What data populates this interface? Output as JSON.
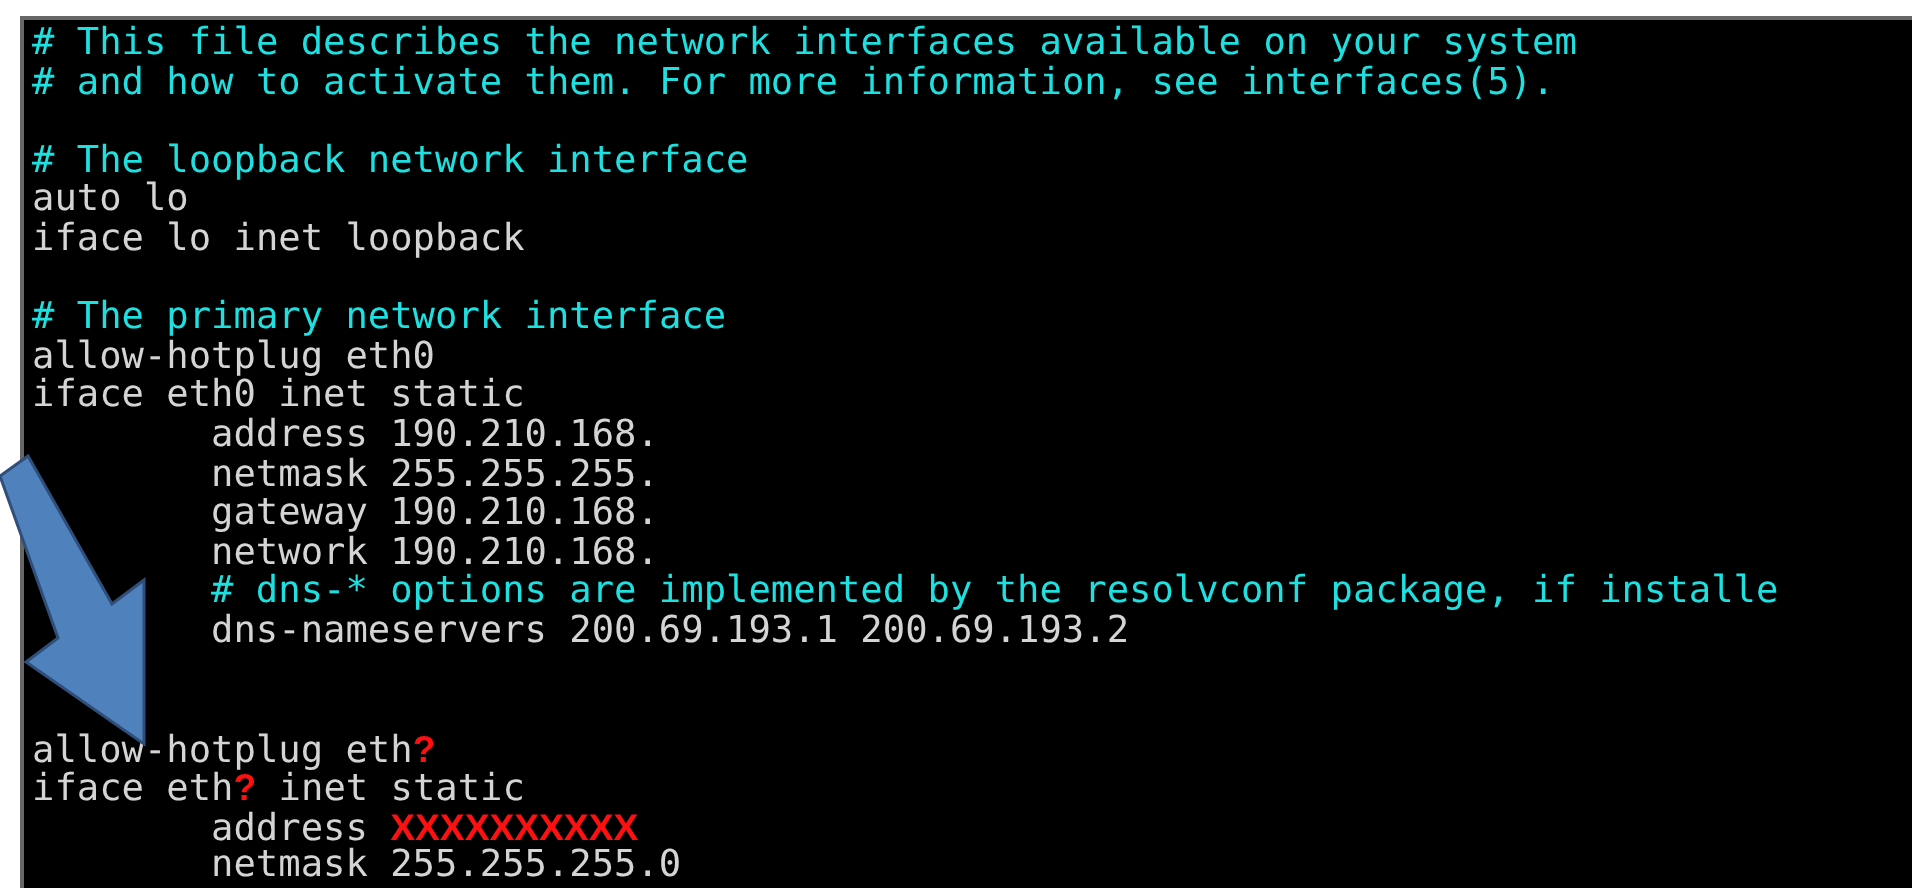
{
  "terminal": {
    "lines": [
      {
        "kind": "comment",
        "indented": false,
        "segments": [
          {
            "kind": "normal",
            "text": "# This file describes the network interfaces available on your system"
          }
        ]
      },
      {
        "kind": "comment",
        "indented": false,
        "segments": [
          {
            "kind": "normal",
            "text": "# and how to activate them. For more information, see interfaces(5)."
          }
        ]
      },
      {
        "kind": "blank"
      },
      {
        "kind": "comment",
        "indented": false,
        "segments": [
          {
            "kind": "normal",
            "text": "# The loopback network interface"
          }
        ]
      },
      {
        "kind": "plain",
        "indented": false,
        "segments": [
          {
            "kind": "normal",
            "text": "auto lo"
          }
        ]
      },
      {
        "kind": "plain",
        "indented": false,
        "segments": [
          {
            "kind": "normal",
            "text": "iface lo inet loopback"
          }
        ]
      },
      {
        "kind": "blank"
      },
      {
        "kind": "comment",
        "indented": false,
        "segments": [
          {
            "kind": "normal",
            "text": "# The primary network interface"
          }
        ]
      },
      {
        "kind": "plain",
        "indented": false,
        "segments": [
          {
            "kind": "normal",
            "text": "allow-hotplug eth0"
          }
        ]
      },
      {
        "kind": "plain",
        "indented": false,
        "segments": [
          {
            "kind": "normal",
            "text": "iface eth0 inet static"
          }
        ]
      },
      {
        "kind": "plain",
        "indented": true,
        "segments": [
          {
            "kind": "normal",
            "text": "address 190.210.168."
          }
        ]
      },
      {
        "kind": "plain",
        "indented": true,
        "segments": [
          {
            "kind": "normal",
            "text": "netmask 255.255.255."
          }
        ]
      },
      {
        "kind": "plain",
        "indented": true,
        "segments": [
          {
            "kind": "normal",
            "text": "gateway 190.210.168."
          }
        ]
      },
      {
        "kind": "plain",
        "indented": true,
        "segments": [
          {
            "kind": "normal",
            "text": "network 190.210.168."
          }
        ]
      },
      {
        "kind": "comment",
        "indented": true,
        "segments": [
          {
            "kind": "normal",
            "text": "# dns-* options are implemented by the resolvconf package, if installe"
          }
        ]
      },
      {
        "kind": "plain",
        "indented": true,
        "segments": [
          {
            "kind": "normal",
            "text": "dns-nameservers 200.69.193.1 200.69.193.2"
          }
        ]
      },
      {
        "kind": "blank"
      },
      {
        "kind": "blank"
      },
      {
        "kind": "plain",
        "indented": false,
        "segments": [
          {
            "kind": "normal",
            "text": "allow-hotplug eth"
          },
          {
            "kind": "redacted",
            "text": "?"
          }
        ]
      },
      {
        "kind": "plain",
        "indented": false,
        "segments": [
          {
            "kind": "normal",
            "text": "iface eth"
          },
          {
            "kind": "redacted",
            "text": "?"
          },
          {
            "kind": "normal",
            "text": " inet static"
          }
        ]
      },
      {
        "kind": "plain",
        "indented": true,
        "segments": [
          {
            "kind": "normal",
            "text": "address "
          },
          {
            "kind": "redacted",
            "text": "XXXXXXXXXX"
          }
        ]
      },
      {
        "kind": "plain",
        "indented": true,
        "segments": [
          {
            "kind": "normal",
            "text": "netmask 255.255.255.0"
          }
        ]
      }
    ]
  }
}
